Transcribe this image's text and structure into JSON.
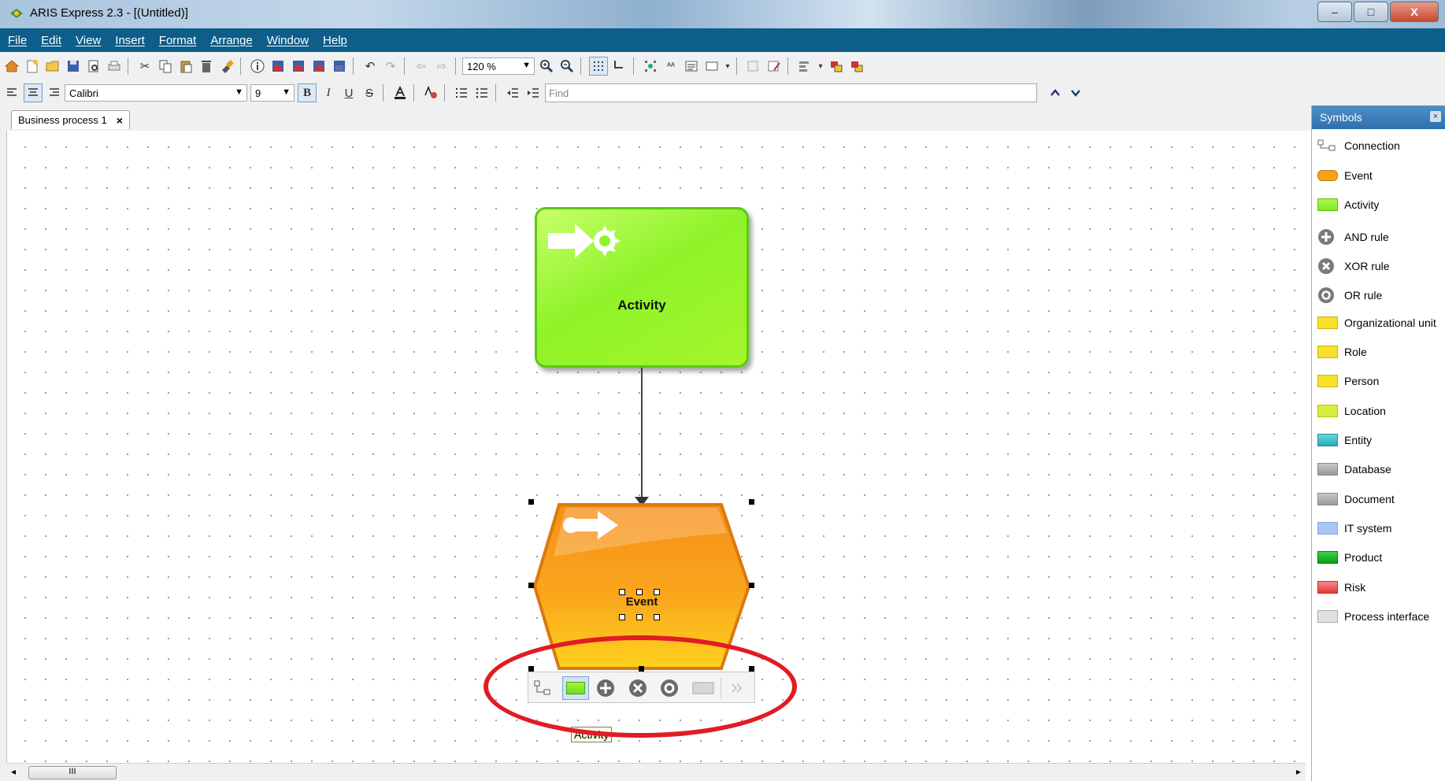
{
  "window": {
    "title": "ARIS Express 2.3 - [(Untitled)]",
    "minimize": "–",
    "maximize": "□",
    "close": "X"
  },
  "menu": [
    "File",
    "Edit",
    "View",
    "Insert",
    "Format",
    "Arrange",
    "Window",
    "Help"
  ],
  "toolbar": {
    "zoom": "120 %",
    "font": "Calibri",
    "font_size": "9",
    "bold": "B",
    "italic": "I",
    "underline": "U",
    "strike": "S",
    "find_placeholder": "Find",
    "find_prev": "^",
    "find_next": "v"
  },
  "tab": {
    "label": "Business process 1",
    "close": "×"
  },
  "canvas": {
    "activity_label": "Activity",
    "event_label": "Event",
    "tooltip": "Activity"
  },
  "scrollbar": {
    "grip": "III",
    "left": "◂",
    "right": "▸"
  },
  "symbols": {
    "title": "Symbols",
    "close": "×",
    "items": [
      {
        "label": "Connection",
        "color": "#ffffff"
      },
      {
        "label": "Event",
        "color": "#f5a21a"
      },
      {
        "label": "Activity",
        "color": "#8ef02a"
      },
      {
        "label": "AND rule",
        "color": "#7a7a7a"
      },
      {
        "label": "XOR rule",
        "color": "#7a7a7a"
      },
      {
        "label": "OR rule",
        "color": "#7a7a7a"
      },
      {
        "label": "Organizational unit",
        "color": "#f6e02a"
      },
      {
        "label": "Role",
        "color": "#f6e02a"
      },
      {
        "label": "Person",
        "color": "#f6e02a"
      },
      {
        "label": "Location",
        "color": "#d7ef3a"
      },
      {
        "label": "Entity",
        "color": "#3fb8c9"
      },
      {
        "label": "Database",
        "color": "#a9a9a9"
      },
      {
        "label": "Document",
        "color": "#a9a9a9"
      },
      {
        "label": "IT system",
        "color": "#a9c8f2"
      },
      {
        "label": "Product",
        "color": "#1fb32a"
      },
      {
        "label": "Risk",
        "color": "#f25a5a"
      },
      {
        "label": "Process interface",
        "color": "#d0d0d0"
      }
    ]
  },
  "colors": {
    "menubar": "#0d5e8a",
    "activity": "#8ff32a",
    "event": "#f7a11e",
    "highlight_oval": "#e01c24"
  }
}
